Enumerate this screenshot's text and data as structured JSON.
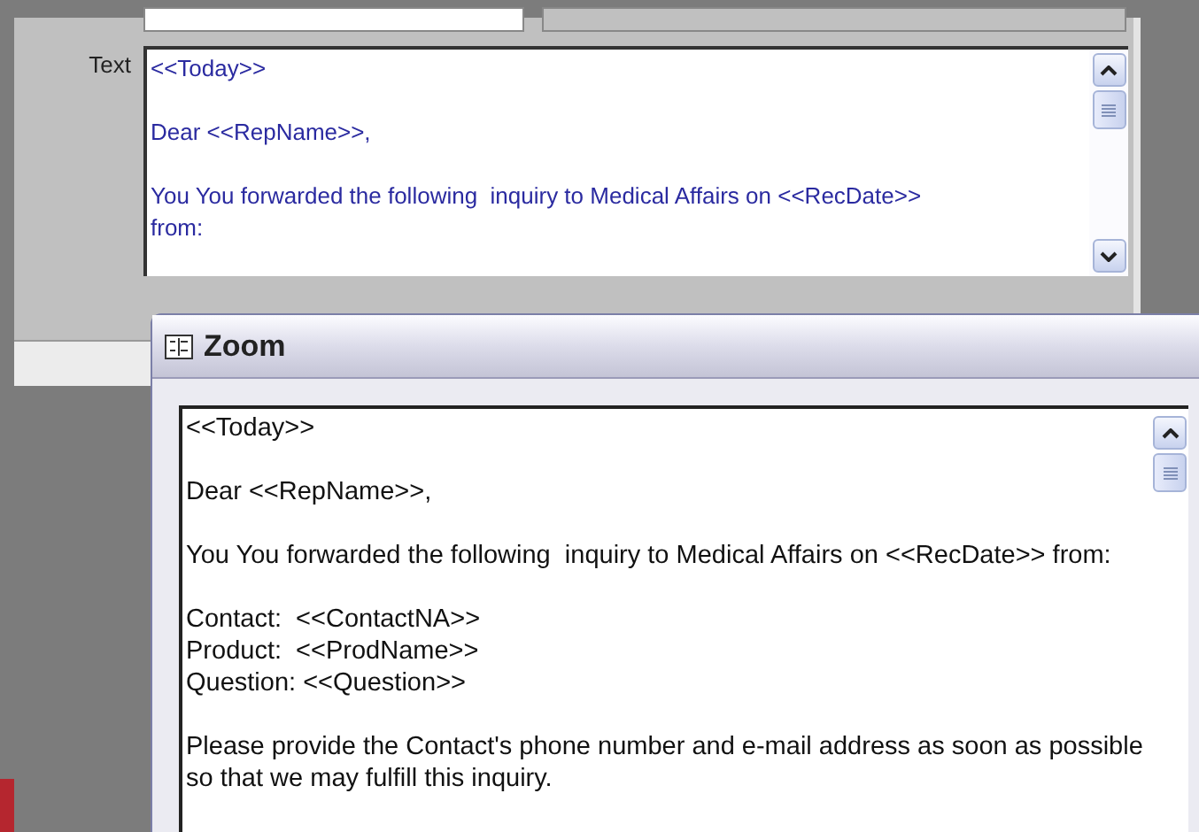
{
  "form": {
    "text_label": "Text",
    "text_field": {
      "paragraphs": [
        [
          "<<Today>>"
        ],
        [
          "Dear <<RepName>>,"
        ],
        [
          "You You forwarded the following  inquiry to Medical Affairs on <<RecDate>> from:"
        ]
      ]
    }
  },
  "zoom_dialog": {
    "title": "Zoom",
    "paragraphs": [
      [
        "<<Today>>"
      ],
      [
        "Dear <<RepName>>,"
      ],
      [
        "You You forwarded the following  inquiry to Medical Affairs on <<RecDate>> from:"
      ],
      [
        "Contact:  <<ContactNA>>",
        "Product:  <<ProdName>>",
        "Question: <<Question>>"
      ],
      [
        "Please provide the Contact's phone number and e-mail address as soon as possible so that we may fulfill this inquiry."
      ]
    ]
  }
}
